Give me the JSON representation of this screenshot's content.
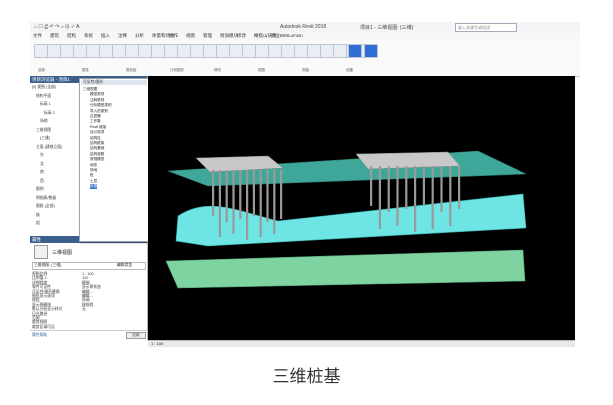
{
  "titlebar": {
    "quick_access": "⌂ ☐ ⎙ ↶ ↷ ⌂ ⊡ ✓ A",
    "app_title": "Autodesk Revit 2018",
    "file": "项目1 - 三维视图: {三维}",
    "search_placeholder": "键入关键字或短语"
  },
  "ribbon_tabs": [
    "文件",
    "建筑",
    "结构",
    "系统",
    "插入",
    "注释",
    "分析",
    "体量和场地",
    "协作",
    "视图",
    "管理",
    "附加模块",
    "修改",
    "橄榄山快模",
    "鸿业BIM",
    "Lumion"
  ],
  "ribbon_panels": [
    "选择",
    "属性",
    "剪贴板",
    "几何图形",
    "修改",
    "视图",
    "测量",
    "创建"
  ],
  "project_browser": {
    "title": "项目浏览器 - 项目1",
    "items": [
      "[0] 视图 (全部)",
      "结构平面",
      "标高 1",
      "标高 2",
      "场地",
      "三维视图",
      "{三维}",
      "立面 (建筑立面)",
      "东",
      "北",
      "南",
      "西",
      "图例",
      "明细表/数量",
      "图纸 (全部)",
      "族",
      "组"
    ]
  },
  "dialog": {
    "title": "可见性/图形",
    "items": [
      "三维视图",
      "模型类别",
      "注释类别",
      "分析模型类别",
      "导入的类别",
      "过滤器",
      "工作集",
      "Revit 链接",
      "设计选项",
      "结构柱",
      "结构框架",
      "结构基础",
      "结构钢筋",
      "常规模型",
      "地形",
      "场地",
      "桩",
      "土层",
      "桩基"
    ]
  },
  "properties": {
    "header": "属性",
    "type_name": "三维视图",
    "selector": "三维视图: {三维}",
    "edit_type": "编辑类型",
    "rows": [
      {
        "label": "视图比例",
        "value": "1 : 100"
      },
      {
        "label": "比例值 1:",
        "value": "100"
      },
      {
        "label": "详细程度",
        "value": "精细"
      },
      {
        "label": "零件可见性",
        "value": "显示原状态"
      },
      {
        "label": "可见性/图形替换",
        "value": "编辑..."
      },
      {
        "label": "图形显示选项",
        "value": "编辑..."
      },
      {
        "label": "规程",
        "value": "协调"
      },
      {
        "label": "显示隐藏线",
        "value": "按规程"
      },
      {
        "label": "默认分析显示样式",
        "value": "无"
      },
      {
        "label": "日光路径",
        "value": ""
      },
      {
        "label": "范围",
        "value": ""
      },
      {
        "label": "裁剪视图",
        "value": ""
      },
      {
        "label": "裁剪区域可见",
        "value": ""
      }
    ],
    "help_link": "属性帮助",
    "apply": "应用"
  },
  "statusbar": {
    "scale": "1 : 100"
  },
  "caption": "三维桩基",
  "colors": {
    "viewport_bg": "#000000",
    "upper_layer": "#3fa79a",
    "middle_layer": "#66e0e0",
    "lower_layer": "#7fd3a0",
    "pile_cap": "#bfbfbf",
    "pile": "#8a8a8a"
  }
}
